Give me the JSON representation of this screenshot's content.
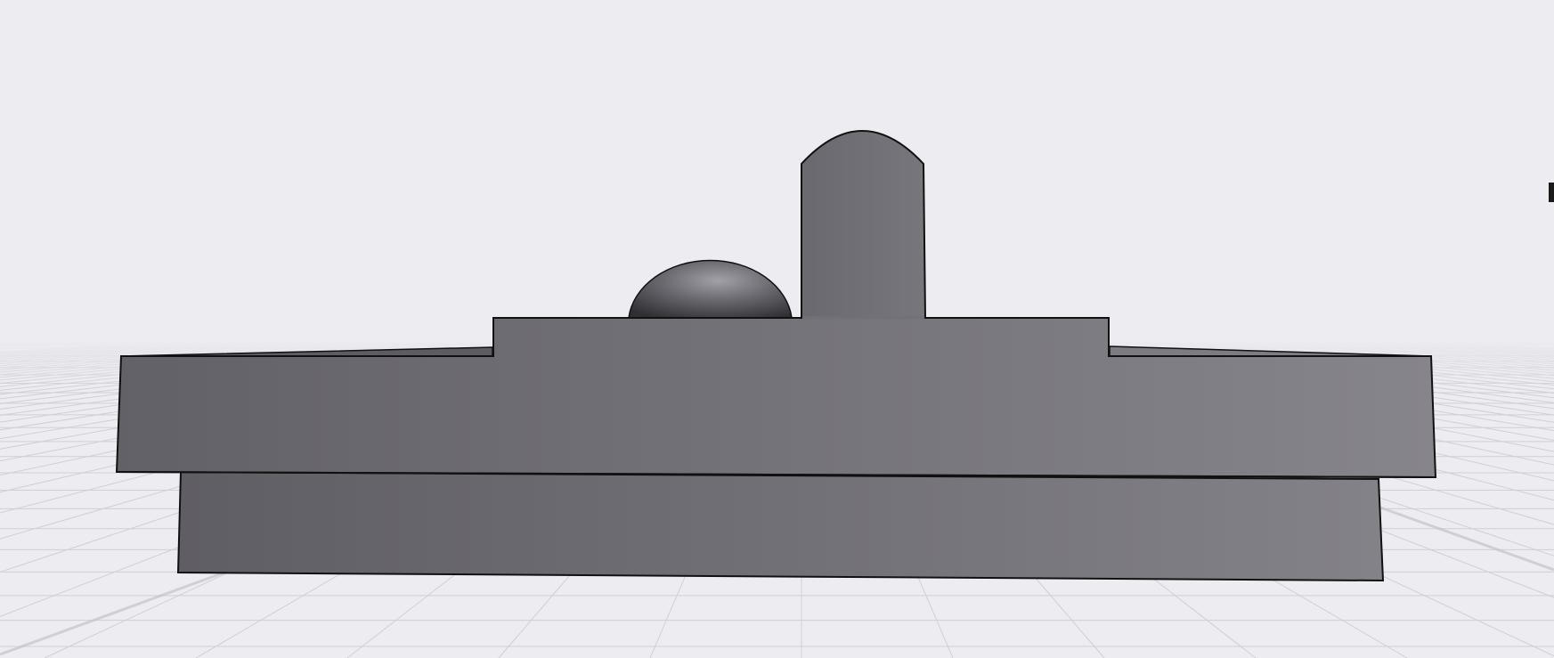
{
  "scene": {
    "view": "3d-viewport",
    "background_color": "#edecf1",
    "grid_color": "#cfcfd6",
    "model_color": "#6e6d73",
    "outline_color": "#111111",
    "objects": [
      "base-plate",
      "top-plate",
      "raised-platform",
      "rounded-tab",
      "dome"
    ]
  }
}
